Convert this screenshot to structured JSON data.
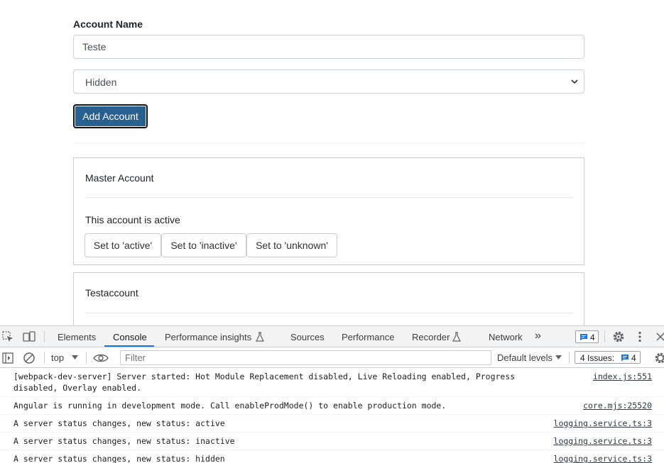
{
  "form": {
    "account_label": "Account Name",
    "account_value": "Teste",
    "status_select_value": "Hidden",
    "add_button_label": "Add Account"
  },
  "accounts": [
    {
      "name": "Master Account",
      "status_text": "This account is active",
      "buttons": [
        "Set to 'active'",
        "Set to 'inactive'",
        "Set to 'unknown'"
      ]
    },
    {
      "name": "Testaccount"
    }
  ],
  "devtools": {
    "tabs": [
      "Elements",
      "Console",
      "Performance insights",
      "Sources",
      "Performance",
      "Recorder",
      "Network"
    ],
    "active_tab": "Console",
    "more_tabs_icon": "»",
    "messages_badge_count": "4",
    "context": "top",
    "filter_placeholder": "Filter",
    "levels_label": "Default levels",
    "issues_label": "4 Issues:",
    "issues_count": "4",
    "logs": [
      {
        "message": "[webpack-dev-server] Server started: Hot Module Replacement disabled, Live Reloading enabled, Progress disabled, Overlay enabled.",
        "source": "index.js:551"
      },
      {
        "message": "Angular is running in development mode. Call enableProdMode() to enable production mode.",
        "source": "core.mjs:25520"
      },
      {
        "message": "A server status changes, new status: active",
        "source": "logging.service.ts:3"
      },
      {
        "message": "A server status changes, new status: inactive",
        "source": "logging.service.ts:3"
      },
      {
        "message": "A server status changes, new status: hidden",
        "source": "logging.service.ts:3"
      }
    ]
  },
  "colors": {
    "primary_button": "#286090",
    "active_tab_underline": "#1a73e8"
  }
}
